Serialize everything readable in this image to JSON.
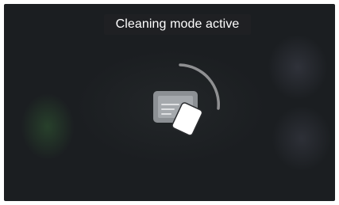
{
  "status": {
    "message": "Cleaning mode active"
  },
  "icons": {
    "cleaning": "wipe-screen-icon",
    "progress": "progress-arc-icon"
  },
  "colors": {
    "background": "#1b1e21",
    "banner": "#1f2023",
    "text": "#ffffff",
    "arc": "#8f9092",
    "screen_icon": "#8c9094",
    "cloth": "#ffffff"
  }
}
